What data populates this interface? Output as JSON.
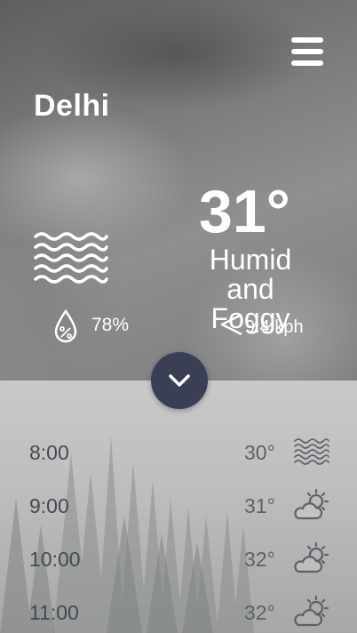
{
  "menu": {
    "icon": "hamburger-menu-icon"
  },
  "location": {
    "city": "Delhi"
  },
  "current": {
    "temperature": "31°",
    "condition": "Humid and Foggy",
    "condition_icon": "fog-icon",
    "humidity": "78%",
    "humidity_icon": "humidity-drop-icon",
    "wind": "9.4 kph",
    "wind_icon": "wind-direction-icon"
  },
  "expand": {
    "icon": "chevron-down-icon",
    "color": "#3b3f55"
  },
  "hourly": [
    {
      "time": "8:00",
      "temp": "30°",
      "icon": "fog-icon"
    },
    {
      "time": "9:00",
      "temp": "31°",
      "icon": "partly-sunny-icon"
    },
    {
      "time": "10:00",
      "temp": "32°",
      "icon": "partly-sunny-icon"
    },
    {
      "time": "11:00",
      "temp": "32°",
      "icon": "partly-sunny-icon"
    }
  ]
}
